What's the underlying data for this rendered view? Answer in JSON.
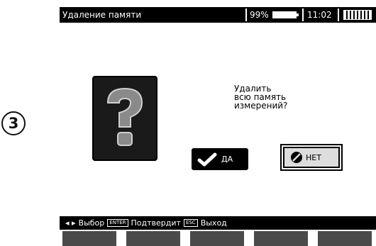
{
  "step_marker": "3",
  "status_bar": {
    "title": "Удаление памяти",
    "battery_percent": "99%",
    "time": "11:02"
  },
  "dialog": {
    "prompt": "Удалить\nвсю память\nизмерений?",
    "yes_label": "ДА",
    "no_label": "НЕТ"
  },
  "hint_bar": {
    "arrows": "◂ ▸",
    "select_label": "Выбор",
    "enter_key": "ENTER",
    "confirm_label": "Подтвердит",
    "esc_key": "ESC",
    "exit_label": "Выход"
  },
  "softkeys": [
    "",
    "",
    "",
    "",
    "",
    ""
  ],
  "colors": {
    "screen_bg": "#ffffff",
    "bar_bg": "#000000",
    "softkey": "#4a4a4a"
  }
}
